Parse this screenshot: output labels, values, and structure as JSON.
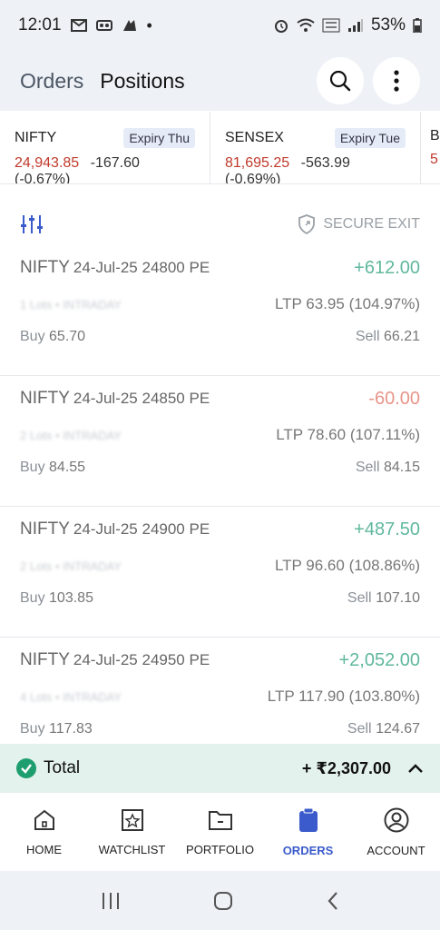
{
  "status_bar": {
    "time": "12:01",
    "battery": "53%",
    "dot": "•"
  },
  "header": {
    "tabs": [
      {
        "label": "Orders",
        "active": false
      },
      {
        "label": "Positions",
        "active": true
      }
    ]
  },
  "indices": [
    {
      "name": "NIFTY",
      "expiry": "Expiry Thu",
      "value": "24,943.85",
      "change": "-167.60 (-0.67%)"
    },
    {
      "name": "SENSEX",
      "expiry": "Expiry Tue",
      "value": "81,695.25",
      "change": "-563.99 (-0.69%)"
    },
    {
      "name": "B",
      "expiry": "",
      "value": "5",
      "change": ""
    }
  ],
  "toolbar": {
    "secure_exit_label": "SECURE EXIT"
  },
  "positions": [
    {
      "symbol": "NIFTY",
      "contract": "24-Jul-25 24800 PE",
      "pnl": "+612.00",
      "meta": "1 Lots • INTRADAY",
      "ltp": "LTP 63.95 (104.97%)",
      "buy_label": "Buy",
      "buy": "65.70",
      "sell_label": "Sell",
      "sell": "66.21",
      "pnl_sign": "pos"
    },
    {
      "symbol": "NIFTY",
      "contract": "24-Jul-25 24850 PE",
      "pnl": "-60.00",
      "meta": "2 Lots • INTRADAY",
      "ltp": "LTP 78.60 (107.11%)",
      "buy_label": "Buy",
      "buy": "84.55",
      "sell_label": "Sell",
      "sell": "84.15",
      "pnl_sign": "neg"
    },
    {
      "symbol": "NIFTY",
      "contract": "24-Jul-25 24900 PE",
      "pnl": "+487.50",
      "meta": "2 Lots • INTRADAY",
      "ltp": "LTP 96.60 (108.86%)",
      "buy_label": "Buy",
      "buy": "103.85",
      "sell_label": "Sell",
      "sell": "107.10",
      "pnl_sign": "pos"
    },
    {
      "symbol": "NIFTY",
      "contract": "24-Jul-25 24950 PE",
      "pnl": "+2,052.00",
      "meta": "4 Lots • INTRADAY",
      "ltp": "LTP 117.90 (103.80%)",
      "buy_label": "Buy",
      "buy": "117.83",
      "sell_label": "Sell",
      "sell": "124.67",
      "pnl_sign": "pos"
    }
  ],
  "total": {
    "label": "Total",
    "value": "+ ₹2,307.00"
  },
  "nav": {
    "items": [
      {
        "label": "HOME",
        "icon": "home-icon"
      },
      {
        "label": "WATCHLIST",
        "icon": "watchlist-icon"
      },
      {
        "label": "PORTFOLIO",
        "icon": "folder-icon"
      },
      {
        "label": "ORDERS",
        "icon": "clipboard-icon"
      },
      {
        "label": "ACCOUNT",
        "icon": "user-icon"
      }
    ],
    "active": "ORDERS"
  },
  "colors": {
    "profit": "#5fb89e",
    "loss": "#e8958a",
    "accent": "#3b5bcc",
    "total_bg": "#e3f2ec"
  }
}
